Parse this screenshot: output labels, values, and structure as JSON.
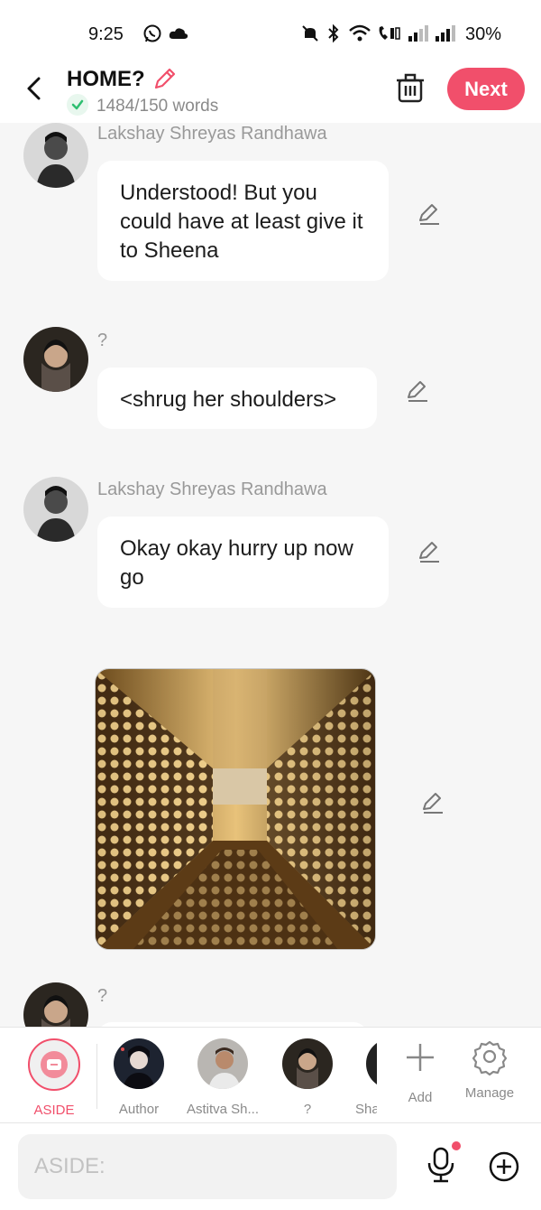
{
  "status_bar": {
    "time": "9:25",
    "battery": "30%"
  },
  "header": {
    "title": "HOME?",
    "word_count": "1484/150 words",
    "next_label": "Next"
  },
  "messages": [
    {
      "sender": "Lakshay Shreyas Randhawa",
      "text": "Understood! But you could have at least give it to Sheena"
    },
    {
      "sender": "?",
      "text": "<shrug her shoulders>"
    },
    {
      "sender": "Lakshay Shreyas Randhawa",
      "text": "Okay okay hurry up now go"
    },
    {
      "sender": "?"
    }
  ],
  "characters": [
    {
      "label": "ASIDE"
    },
    {
      "label": "Author"
    },
    {
      "label": "Astitva Sh..."
    },
    {
      "label": "?"
    },
    {
      "label": "Sha"
    }
  ],
  "actions": {
    "add_label": "Add",
    "manage_label": "Manage"
  },
  "input": {
    "placeholder": "ASIDE:"
  },
  "colors": {
    "accent": "#f14f6b",
    "check": "#2fbf71",
    "background": "#f6f6f6"
  }
}
